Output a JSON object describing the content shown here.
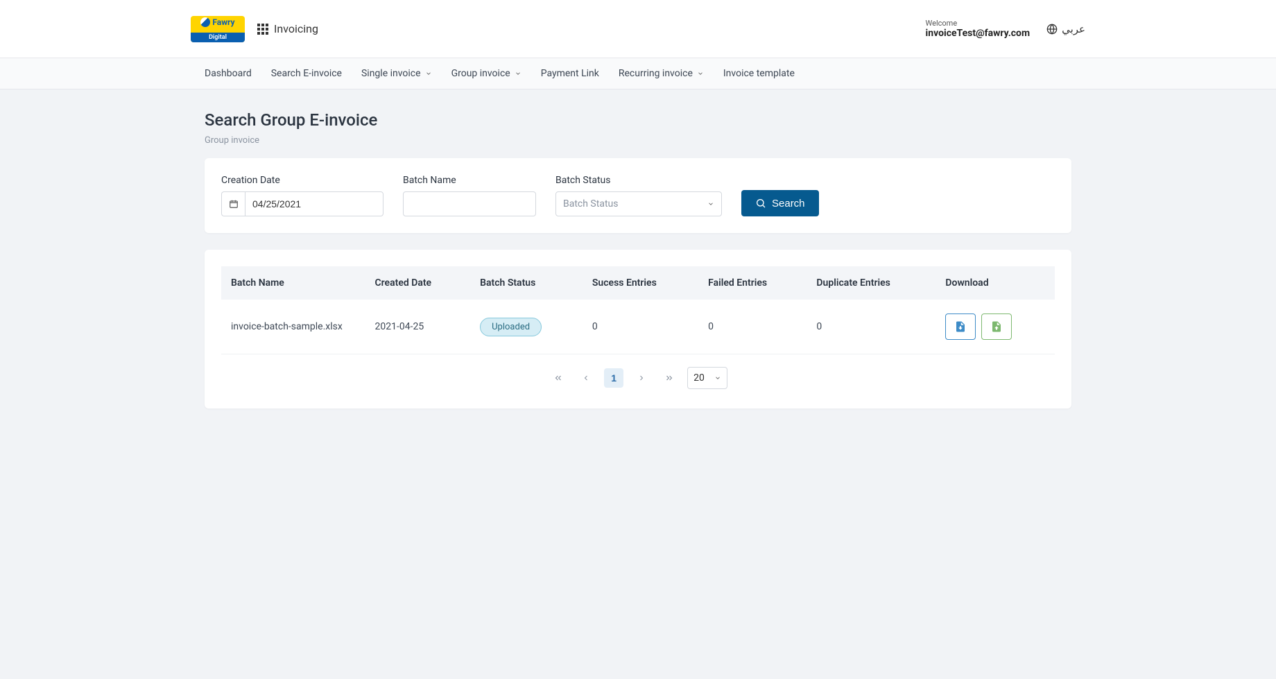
{
  "header": {
    "logo_brand": "Fawry",
    "logo_sub": "Digital",
    "app_name": "Invoicing",
    "welcome_label": "Welcome",
    "user_email": "invoiceTest@fawry.com",
    "language": "عربي"
  },
  "nav": {
    "items": [
      "Dashboard",
      "Search E-invoice",
      "Single invoice",
      "Group invoice",
      "Payment Link",
      "Recurring invoice",
      "Invoice template"
    ],
    "dropdown_flags": [
      false,
      false,
      true,
      true,
      false,
      true,
      false
    ]
  },
  "page": {
    "title": "Search Group E-invoice",
    "breadcrumb": "Group invoice"
  },
  "filters": {
    "creation_date_label": "Creation Date",
    "creation_date_value": "04/25/2021",
    "batch_name_label": "Batch Name",
    "batch_name_value": "",
    "batch_status_label": "Batch Status",
    "batch_status_placeholder": "Batch Status",
    "search_label": "Search"
  },
  "table": {
    "columns": [
      "Batch Name",
      "Created Date",
      "Batch Status",
      "Sucess Entries",
      "Failed Entries",
      "Duplicate Entries",
      "Download"
    ],
    "rows": [
      {
        "batch_name": "invoice-batch-sample.xlsx",
        "created_date": "2021-04-25",
        "batch_status": "Uploaded",
        "success_entries": "0",
        "failed_entries": "0",
        "duplicate_entries": "0"
      }
    ]
  },
  "pagination": {
    "current_page": "1",
    "page_size": "20"
  }
}
